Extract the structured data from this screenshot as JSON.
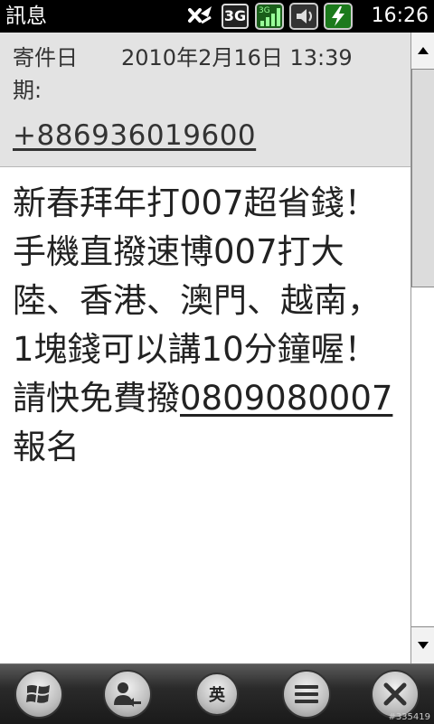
{
  "statusbar": {
    "title": "訊息",
    "network_label": "3G",
    "signal_label": "3G",
    "clock": "16:26",
    "icons": [
      "connection-icon",
      "network-3g-icon",
      "signal-icon",
      "volume-icon",
      "battery-charging-icon"
    ]
  },
  "header": {
    "from_label_line1": "寄件日",
    "from_label_line2": "期:",
    "date": "2010年2月16日 13:39",
    "phone": "+886936019600"
  },
  "message": {
    "text_before_link": "新春拜年打007超省錢！手機直撥速博007打大陸、香港、澳門、越南，1塊錢可以講10分鐘喔！請快免費撥",
    "link": "0809080007",
    "text_after_link": "報名"
  },
  "toolbar": {
    "input_mode_label": "英",
    "watermark": "#335419"
  }
}
